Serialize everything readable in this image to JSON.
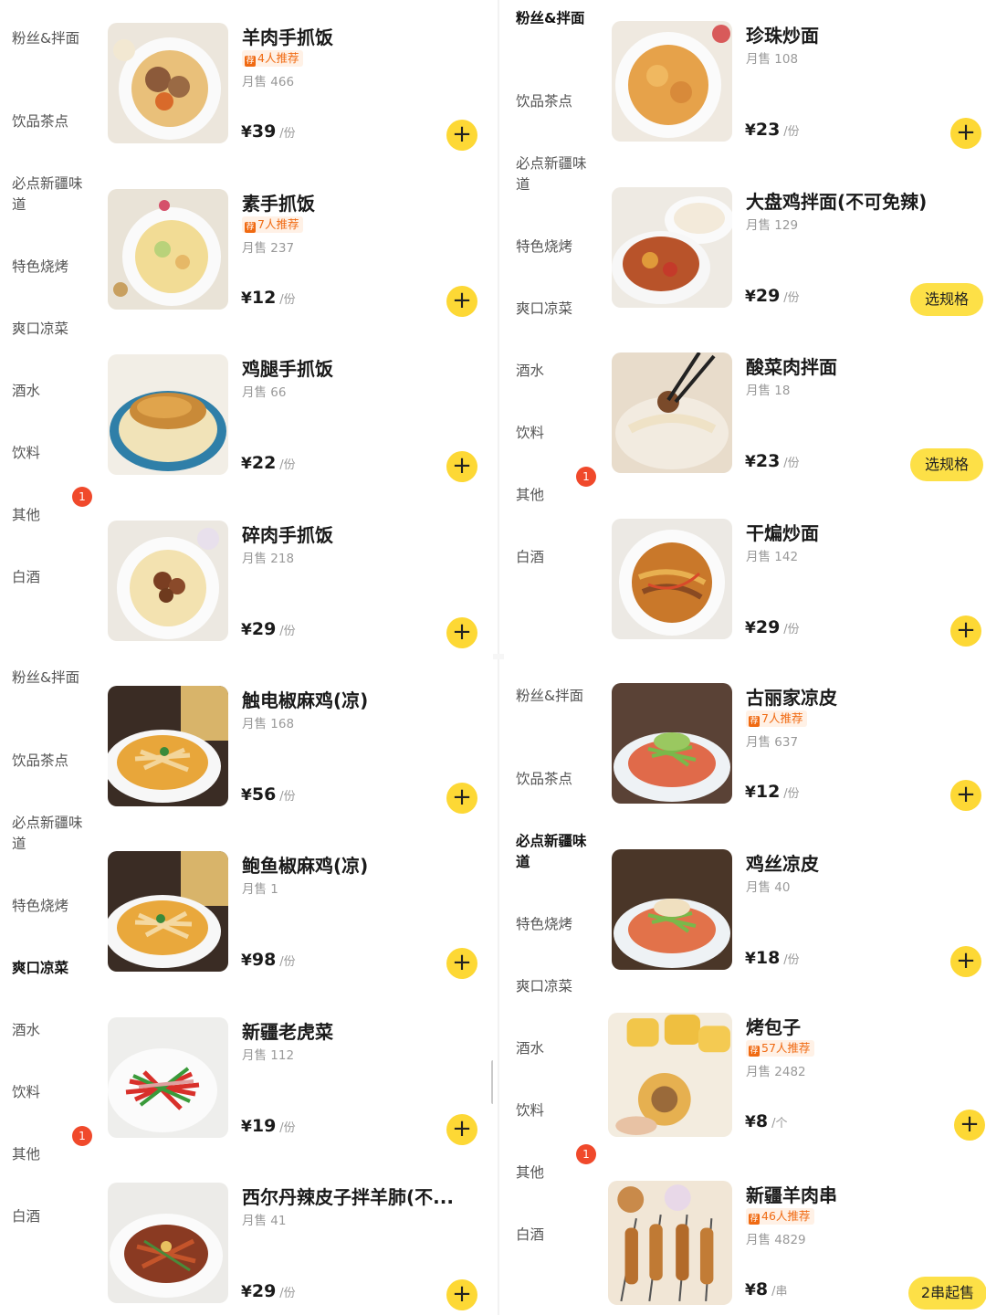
{
  "panels": {
    "top_left": {
      "categories": [
        {
          "label": "粉丝&拌面"
        },
        {
          "label": "饮品茶点"
        },
        {
          "label": "必点新疆味道"
        },
        {
          "label": "特色烧烤"
        },
        {
          "label": "爽口凉菜"
        },
        {
          "label": "酒水"
        },
        {
          "label": "饮料"
        },
        {
          "label": "其他"
        },
        {
          "label": "白酒"
        }
      ],
      "badge": "1",
      "items": [
        {
          "name": "羊肉手抓饭",
          "rec": "4人推荐",
          "sold": "月售 466",
          "currency": "¥",
          "price": "39",
          "unit": "/份",
          "action": "+"
        },
        {
          "name": "素手抓饭",
          "rec": "7人推荐",
          "sold": "月售 237",
          "currency": "¥",
          "price": "12",
          "unit": "/份",
          "action": "+"
        },
        {
          "name": "鸡腿手抓饭",
          "sold": "月售 66",
          "currency": "¥",
          "price": "22",
          "unit": "/份",
          "action": "+"
        },
        {
          "name": "碎肉手抓饭",
          "sold": "月售 218",
          "currency": "¥",
          "price": "29",
          "unit": "/份",
          "action": "+"
        }
      ]
    },
    "top_right": {
      "categories": [
        {
          "label": "粉丝&拌面"
        },
        {
          "label": "饮品茶点"
        },
        {
          "label": "必点新疆味道"
        },
        {
          "label": "特色烧烤"
        },
        {
          "label": "爽口凉菜"
        },
        {
          "label": "酒水"
        },
        {
          "label": "饮料"
        },
        {
          "label": "其他"
        },
        {
          "label": "白酒"
        }
      ],
      "badge": "1",
      "items": [
        {
          "name": "珍珠炒面",
          "sold": "月售 108",
          "currency": "¥",
          "price": "23",
          "unit": "/份",
          "action": "+"
        },
        {
          "name": "大盘鸡拌面(不可免辣)",
          "sold": "月售 129",
          "currency": "¥",
          "price": "29",
          "unit": "/份",
          "action": "选规格"
        },
        {
          "name": "酸菜肉拌面",
          "sold": "月售 18",
          "currency": "¥",
          "price": "23",
          "unit": "/份",
          "action": "选规格"
        },
        {
          "name": "干煸炒面",
          "sold": "月售 142",
          "currency": "¥",
          "price": "29",
          "unit": "/份",
          "action": "+"
        }
      ]
    },
    "bottom_left": {
      "categories": [
        {
          "label": "粉丝&拌面"
        },
        {
          "label": "饮品茶点"
        },
        {
          "label": "必点新疆味道"
        },
        {
          "label": "特色烧烤"
        },
        {
          "label": "爽口凉菜"
        },
        {
          "label": "酒水"
        },
        {
          "label": "饮料"
        },
        {
          "label": "其他"
        },
        {
          "label": "白酒"
        }
      ],
      "badge": "1",
      "items": [
        {
          "name": "触电椒麻鸡(凉)",
          "sold": "月售 168",
          "currency": "¥",
          "price": "56",
          "unit": "/份",
          "action": "+"
        },
        {
          "name": "鲍鱼椒麻鸡(凉)",
          "sold": "月售 1",
          "currency": "¥",
          "price": "98",
          "unit": "/份",
          "action": "+"
        },
        {
          "name": "新疆老虎菜",
          "sold": "月售 112",
          "currency": "¥",
          "price": "19",
          "unit": "/份",
          "action": "+"
        },
        {
          "name": "西尔丹辣皮子拌羊肺(不...",
          "sold": "月售 41",
          "currency": "¥",
          "price": "29",
          "unit": "/份",
          "action": "+"
        }
      ]
    },
    "bottom_right": {
      "categories": [
        {
          "label": "粉丝&拌面"
        },
        {
          "label": "饮品茶点"
        },
        {
          "label": "必点新疆味道"
        },
        {
          "label": "特色烧烤"
        },
        {
          "label": "爽口凉菜"
        },
        {
          "label": "酒水"
        },
        {
          "label": "饮料"
        },
        {
          "label": "其他"
        },
        {
          "label": "白酒"
        }
      ],
      "badge": "1",
      "items": [
        {
          "name": "古丽家凉皮",
          "rec": "7人推荐",
          "sold": "月售 637",
          "currency": "¥",
          "price": "12",
          "unit": "/份",
          "action": "+"
        },
        {
          "name": "鸡丝凉皮",
          "sold": "月售 40",
          "currency": "¥",
          "price": "18",
          "unit": "/份",
          "action": "+"
        },
        {
          "name": "烤包子",
          "rec": "57人推荐",
          "sold": "月售 2482",
          "currency": "¥",
          "price": "8",
          "unit": "/个",
          "action": "+"
        },
        {
          "name": "新疆羊肉串",
          "rec": "46人推荐",
          "sold": "月售 4829",
          "currency": "¥",
          "price": "8",
          "unit": "/串",
          "action": "2串起售"
        }
      ]
    }
  },
  "rec_icon": "recommend-icon",
  "colors": {
    "accent": "#fdd835",
    "badge": "#f0492b",
    "recommend": "#f06a12"
  }
}
